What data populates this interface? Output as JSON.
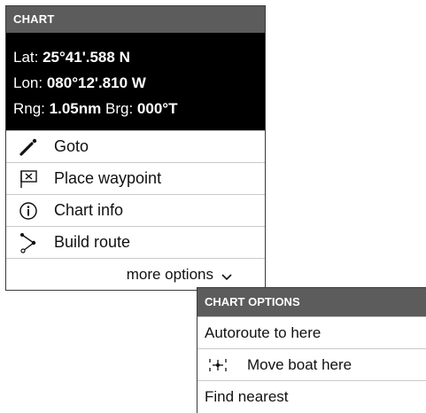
{
  "chart_menu": {
    "header": "CHART",
    "position": {
      "lat_label": "Lat:",
      "lat_value": "25°41'.588 N",
      "lon_label": "Lon:",
      "lon_value": "080°12'.810 W",
      "rng_label": "Rng:",
      "rng_value": "1.05nm",
      "brg_label": "Brg:",
      "brg_value": "000°T"
    },
    "items": [
      {
        "label": "Goto",
        "icon": "goto-icon"
      },
      {
        "label": "Place waypoint",
        "icon": "waypoint-flag-icon"
      },
      {
        "label": "Chart info",
        "icon": "info-icon"
      },
      {
        "label": "Build route",
        "icon": "build-route-icon"
      }
    ],
    "more_options_label": "more options"
  },
  "chart_options": {
    "header": "CHART OPTIONS",
    "items": [
      {
        "label": "Autoroute to here"
      },
      {
        "label": "Move boat here",
        "icon": "move-boat-icon"
      },
      {
        "label": "Find nearest"
      }
    ]
  }
}
